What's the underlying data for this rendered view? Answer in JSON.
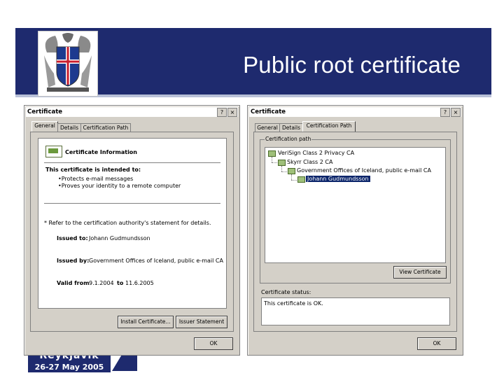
{
  "slide": {
    "title": "Public root certificate",
    "colors": {
      "banner": "#1e2a6e",
      "accent_red": "#c91f2e",
      "dialog_face": "#d4d0c8",
      "selection": "#0a246a"
    },
    "event_logo": {
      "city": "Reykjavik",
      "dates": "26-27 May 2005"
    }
  },
  "dialog_general": {
    "title": "Certificate",
    "help_btn": "?",
    "close_btn": "×",
    "tabs": [
      "General",
      "Details",
      "Certification Path"
    ],
    "active_tab": "General",
    "info_header": "Certificate Information",
    "intended_header": "This certificate is intended to:",
    "purposes": [
      "•Protects e-mail messages",
      "•Proves your identity to a remote computer"
    ],
    "note": "* Refer to the certification authority's statement for details.",
    "issued_to_label": "Issued to:",
    "issued_to_value": "Johann Gudmundsson",
    "issued_by_label": "Issued by:",
    "issued_by_value": "Government Offices of Iceland, public e-mail CA",
    "valid_label": "Valid from",
    "valid_from": "9.1.2004",
    "valid_to_label": "to",
    "valid_to": "11.6.2005",
    "install_btn": "Install Certificate...",
    "issuer_btn": "Issuer Statement",
    "ok_btn": "OK"
  },
  "dialog_path": {
    "title": "Certificate",
    "help_btn": "?",
    "close_btn": "×",
    "tabs": [
      "General",
      "Details",
      "Certification Path"
    ],
    "active_tab": "Certification Path",
    "path_label": "Certification path",
    "path": [
      "VeriSign Class 2 Privacy CA",
      "Skyrr Class 2 CA",
      "Government Offices of Iceland, public e-mail CA",
      "Johann Gudmundsson"
    ],
    "selected_index": 3,
    "view_btn": "View Certificate",
    "status_label": "Certificate status:",
    "status_value": "This certificate is OK.",
    "ok_btn": "OK"
  }
}
